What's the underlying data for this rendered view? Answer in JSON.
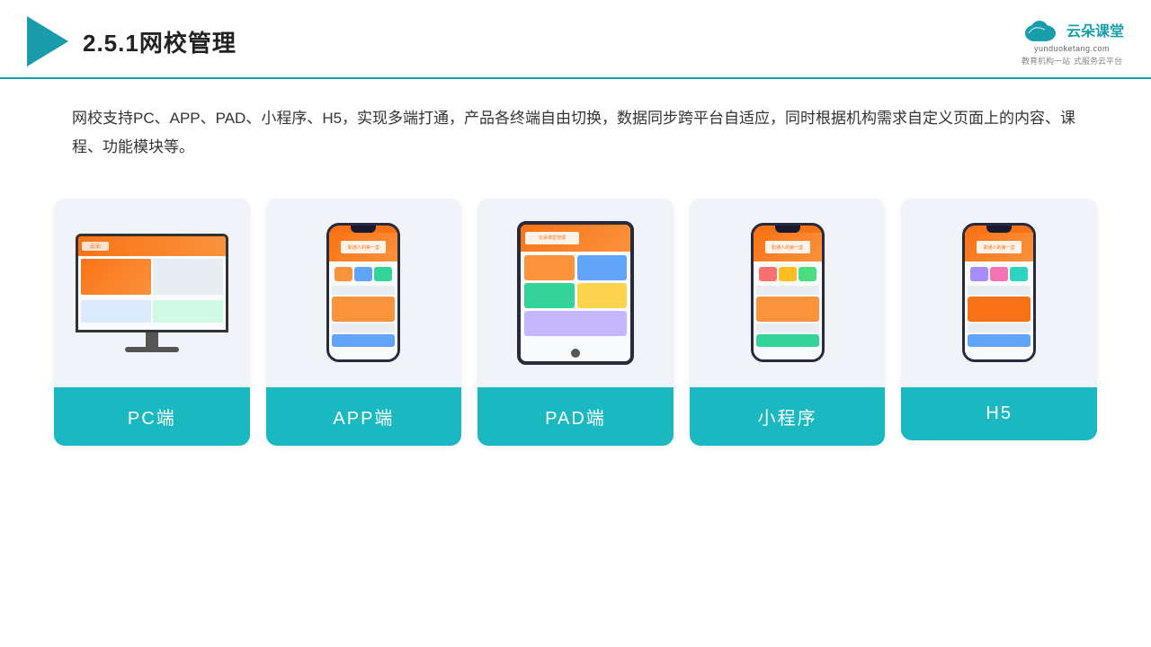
{
  "header": {
    "title": "2.5.1网校管理",
    "brand": {
      "name": "云朵课堂",
      "url": "yunduoketang.com",
      "sub1": "教育机构一站",
      "sub2": "式服务云平台"
    }
  },
  "description": {
    "text": "网校支持PC、APP、PAD、小程序、H5，实现多端打通，产品各终端自由切换，数据同步跨平台自适应，同时根据机构需求自定义页面上的内容、课程、功能模块等。"
  },
  "cards": [
    {
      "id": "pc",
      "label": "PC端"
    },
    {
      "id": "app",
      "label": "APP端"
    },
    {
      "id": "pad",
      "label": "PAD端"
    },
    {
      "id": "miniapp",
      "label": "小程序"
    },
    {
      "id": "h5",
      "label": "H5"
    }
  ]
}
